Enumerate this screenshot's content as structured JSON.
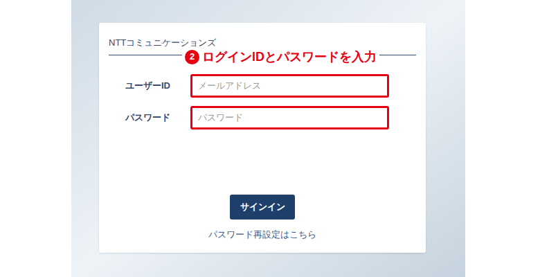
{
  "brand": "NTTコミュニケーションズ",
  "annotation": {
    "badge": "2",
    "text": "ログインIDとパスワードを入力"
  },
  "fields": [
    {
      "label": "ユーザーID",
      "placeholder": "メールアドレス",
      "highlighted": true
    },
    {
      "label": "パスワード",
      "placeholder": "パスワード",
      "highlighted": true
    }
  ],
  "button": "サインイン",
  "link": "パスワード再設定はこちら"
}
